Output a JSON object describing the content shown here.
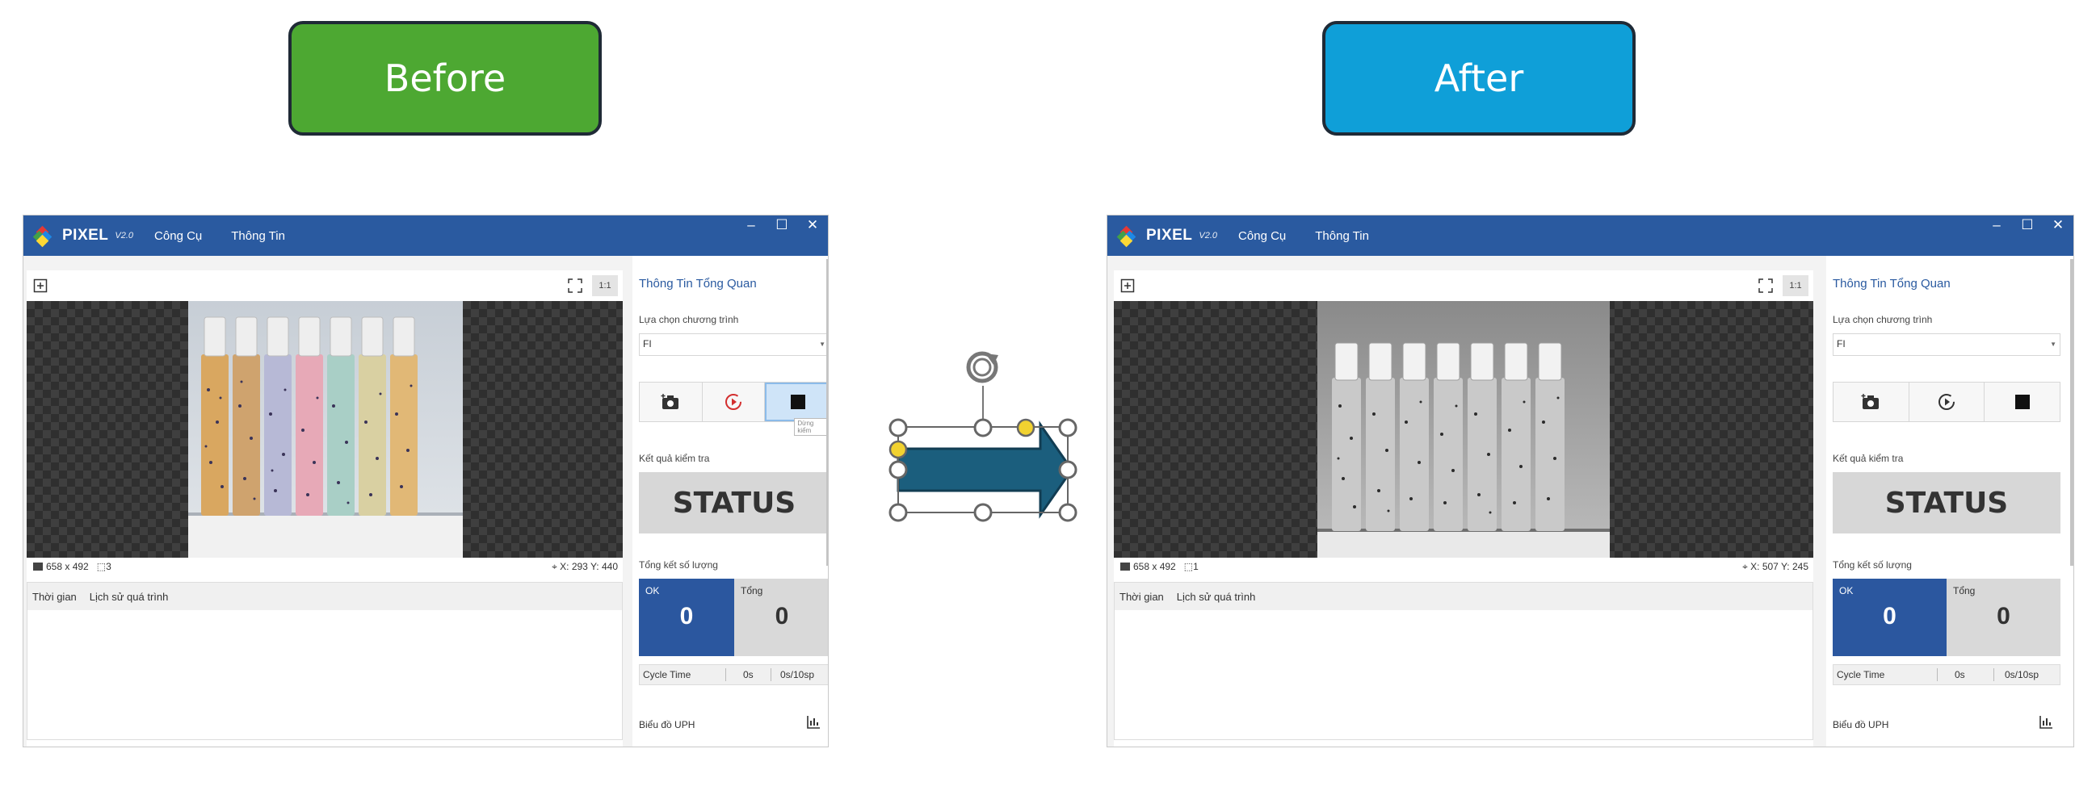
{
  "labels": {
    "before": "Before",
    "after": "After"
  },
  "app": {
    "name": "PIXEL",
    "version": "V2.0",
    "menu": [
      "Công Cụ",
      "Thông Tin"
    ]
  },
  "window_controls": {
    "minimize": "–",
    "maximize": "☐",
    "close": "✕"
  },
  "viewer": {
    "fit_label": "1:1"
  },
  "left_panel": {
    "history_cols": [
      "Thời gian",
      "Lịch sử quá trình"
    ]
  },
  "right_panel": {
    "title": "Thông Tin Tổng Quan",
    "program_label": "Lựa chọn chương trình",
    "program_value": "FI",
    "result_label": "Kết quả kiểm tra",
    "status": "STATUS",
    "summary_label": "Tổng kết số lượng",
    "ok_label": "OK",
    "ok_value": "0",
    "total_label": "Tổng",
    "total_value": "0",
    "cycle_label": "Cycle Time",
    "cycle_value": "0s",
    "rate_value": "0s/10sp",
    "uph_label": "Biểu đồ UPH"
  },
  "before": {
    "image_size": "658 x 492",
    "layers": "3",
    "coords": "X: 293 Y: 440",
    "tooltip": "Dừng kiểm"
  },
  "after": {
    "image_size": "658 x 492",
    "layers": "1",
    "coords": "X: 507 Y: 245"
  },
  "colors": {
    "before_box": "#4da832",
    "after_box": "#0f9fd8",
    "titlebar": "#2a5aa0",
    "ok_cell": "#2b579f",
    "arrow": "#1b5e7d",
    "handle_yellow": "#f1d230"
  }
}
